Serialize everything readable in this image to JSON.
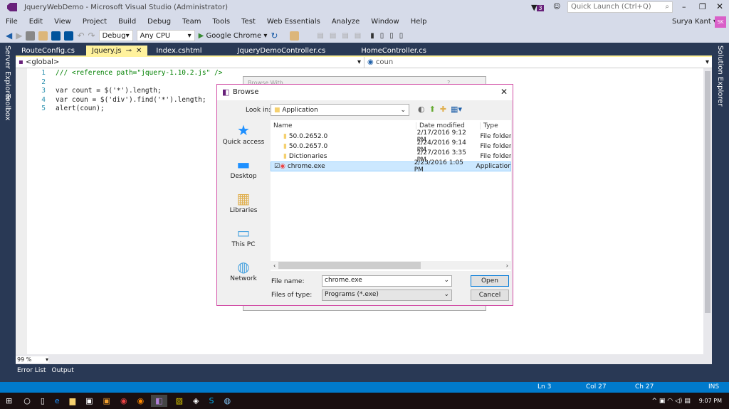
{
  "window": {
    "title": "JqueryWebDemo - Microsoft Visual Studio (Administrator)",
    "notification_count": "3",
    "quick_launch_placeholder": "Quick Launch (Ctrl+Q)",
    "user": "Surya Kant",
    "user_initials": "SK"
  },
  "menu": [
    "File",
    "Edit",
    "View",
    "Project",
    "Build",
    "Debug",
    "Team",
    "Tools",
    "Test",
    "Web Essentials",
    "Analyze",
    "Window",
    "Help"
  ],
  "toolbar": {
    "config": "Debug",
    "platform": "Any CPU",
    "run_target": "Google Chrome"
  },
  "side": {
    "left": [
      "Server Explorer",
      "Toolbox"
    ],
    "right": "Solution Explorer"
  },
  "tabs": [
    {
      "label": "RouteConfig.cs"
    },
    {
      "label": "Jquery.js",
      "active": true
    },
    {
      "label": "Index.cshtml"
    },
    {
      "label": "JqueryDemoController.cs"
    },
    {
      "label": "HomeController.cs"
    }
  ],
  "navbar": {
    "scope": "<global>",
    "member": "coun"
  },
  "code": [
    {
      "n": "1",
      "text": "/// <reference path=\"jquery-1.10.2.js\" />"
    },
    {
      "n": "2",
      "text": ""
    },
    {
      "n": "3",
      "text": "var count = $('*').length;"
    },
    {
      "n": "4",
      "text": "var coun = $('div').find('*').length;"
    },
    {
      "n": "5",
      "text": "alert(coun);"
    }
  ],
  "back_dialog": {
    "title": "Browse With",
    "help": "?"
  },
  "dialog": {
    "title": "Browse",
    "look_in_label": "Look in:",
    "look_in": "Application",
    "places": [
      "Quick access",
      "Desktop",
      "Libraries",
      "This PC",
      "Network"
    ],
    "columns": [
      "Name",
      "Date modified",
      "Type"
    ],
    "files": [
      {
        "name": "50.0.2652.0",
        "date": "2/17/2016 9:12 PM",
        "type": "File folder"
      },
      {
        "name": "50.0.2657.0",
        "date": "2/24/2016 9:14 PM",
        "type": "File folder"
      },
      {
        "name": "Dictionaries",
        "date": "2/27/2016 3:35 PM",
        "type": "File folder"
      },
      {
        "name": "chrome.exe",
        "date": "2/23/2016 1:05 PM",
        "type": "Application",
        "selected": true
      }
    ],
    "file_name_label": "File name:",
    "file_name": "chrome.exe",
    "file_type_label": "Files of type:",
    "file_type": "Programs (*.exe)",
    "open": "Open",
    "cancel": "Cancel"
  },
  "zoom": "99 %",
  "bottom_tabs": [
    "Error List",
    "Output"
  ],
  "status": {
    "ln": "Ln 3",
    "col": "Col 27",
    "ch": "Ch 27",
    "mode": "INS"
  },
  "taskbar": {
    "time": "9:07 PM"
  },
  "colors": {
    "accent": "#007acc",
    "chrome": "#293955",
    "dialog_border": "#d24fa6"
  }
}
